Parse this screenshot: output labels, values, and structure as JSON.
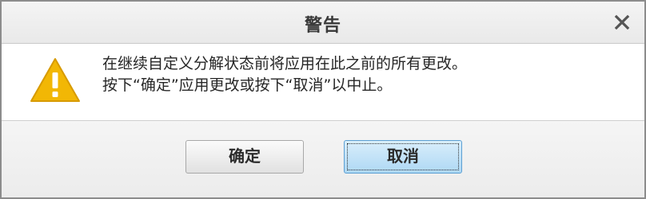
{
  "dialog": {
    "title": "警告",
    "close_icon": "close-icon",
    "warning_icon": "warning-triangle-icon",
    "message_line1": "在继续自定义分解状态前将应用在此之前的所有更改。",
    "message_line2": "按下“确定”应用更改或按下“取消”以中止。",
    "ok_label": "确定",
    "cancel_label": "取消",
    "accent_color": "#f2b705",
    "focused_button": "cancel"
  }
}
